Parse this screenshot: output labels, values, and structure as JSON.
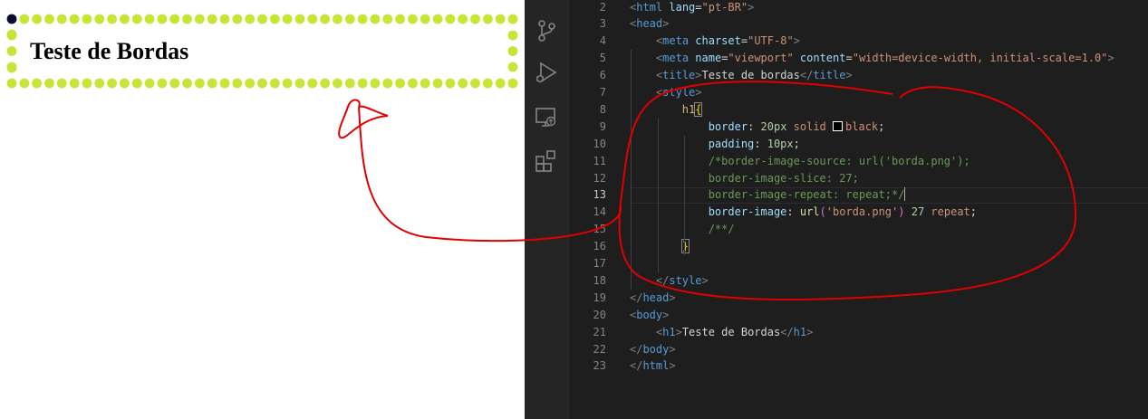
{
  "preview": {
    "heading": "Teste de Bordas",
    "border_color": "#c5e636",
    "corner_color": "#0a0a2e"
  },
  "activity_bar": {
    "icons": [
      "source-control-icon",
      "run-debug-icon",
      "remote-explorer-icon",
      "extensions-icon"
    ]
  },
  "editor": {
    "active_line": 13,
    "lines": [
      {
        "n": "2",
        "parts": [
          {
            "c": "tk-punct",
            "t": "<"
          },
          {
            "c": "tk-tag",
            "t": "html"
          },
          {
            "c": "tk-text",
            "t": " "
          },
          {
            "c": "tk-attr",
            "t": "lang"
          },
          {
            "c": "tk-text",
            "t": "="
          },
          {
            "c": "tk-str",
            "t": "\"pt-BR\""
          },
          {
            "c": "tk-punct",
            "t": ">"
          }
        ]
      },
      {
        "n": "3",
        "parts": [
          {
            "c": "tk-punct",
            "t": "<"
          },
          {
            "c": "tk-tag",
            "t": "head"
          },
          {
            "c": "tk-punct",
            "t": ">"
          }
        ]
      },
      {
        "n": "4",
        "parts": [
          {
            "c": "tk-text",
            "t": "    "
          },
          {
            "c": "tk-punct",
            "t": "<"
          },
          {
            "c": "tk-tag",
            "t": "meta"
          },
          {
            "c": "tk-text",
            "t": " "
          },
          {
            "c": "tk-attr",
            "t": "charset"
          },
          {
            "c": "tk-text",
            "t": "="
          },
          {
            "c": "tk-str",
            "t": "\"UTF-8\""
          },
          {
            "c": "tk-punct",
            "t": ">"
          }
        ]
      },
      {
        "n": "5",
        "parts": [
          {
            "c": "tk-text",
            "t": "    "
          },
          {
            "c": "tk-punct",
            "t": "<"
          },
          {
            "c": "tk-tag",
            "t": "meta"
          },
          {
            "c": "tk-text",
            "t": " "
          },
          {
            "c": "tk-attr",
            "t": "name"
          },
          {
            "c": "tk-text",
            "t": "="
          },
          {
            "c": "tk-str",
            "t": "\"viewport\""
          },
          {
            "c": "tk-text",
            "t": " "
          },
          {
            "c": "tk-attr",
            "t": "content"
          },
          {
            "c": "tk-text",
            "t": "="
          },
          {
            "c": "tk-str",
            "t": "\"width=device-width, initial-scale=1.0\""
          },
          {
            "c": "tk-punct",
            "t": ">"
          }
        ]
      },
      {
        "n": "6",
        "parts": [
          {
            "c": "tk-text",
            "t": "    "
          },
          {
            "c": "tk-punct",
            "t": "<"
          },
          {
            "c": "tk-tag",
            "t": "title"
          },
          {
            "c": "tk-punct",
            "t": ">"
          },
          {
            "c": "tk-text",
            "t": "Teste de bordas"
          },
          {
            "c": "tk-punct",
            "t": "</"
          },
          {
            "c": "tk-tag",
            "t": "title"
          },
          {
            "c": "tk-punct",
            "t": ">"
          }
        ]
      },
      {
        "n": "7",
        "parts": [
          {
            "c": "tk-text",
            "t": "    "
          },
          {
            "c": "tk-punct",
            "t": "<"
          },
          {
            "c": "tk-tag",
            "t": "style"
          },
          {
            "c": "tk-punct",
            "t": ">"
          }
        ]
      },
      {
        "n": "8",
        "parts": [
          {
            "c": "tk-text",
            "t": "        "
          },
          {
            "c": "tk-sel",
            "t": "h1"
          },
          {
            "c": "tk-brace-hl",
            "t": "{"
          }
        ]
      },
      {
        "n": "9",
        "parts": [
          {
            "c": "tk-text",
            "t": "            "
          },
          {
            "c": "tk-prop",
            "t": "border"
          },
          {
            "c": "tk-text",
            "t": ": "
          },
          {
            "c": "tk-num",
            "t": "20px"
          },
          {
            "c": "tk-text",
            "t": " "
          },
          {
            "c": "tk-val",
            "t": "solid"
          },
          {
            "c": "tk-text",
            "t": " "
          },
          {
            "c": "swatch",
            "t": ""
          },
          {
            "c": "tk-val",
            "t": "black"
          },
          {
            "c": "tk-text",
            "t": ";"
          }
        ]
      },
      {
        "n": "10",
        "parts": [
          {
            "c": "tk-text",
            "t": "            "
          },
          {
            "c": "tk-prop",
            "t": "padding"
          },
          {
            "c": "tk-text",
            "t": ": "
          },
          {
            "c": "tk-num",
            "t": "10px"
          },
          {
            "c": "tk-text",
            "t": ";"
          }
        ]
      },
      {
        "n": "11",
        "parts": [
          {
            "c": "tk-text",
            "t": "            "
          },
          {
            "c": "tk-comment",
            "t": "/*border-image-source: url('borda.png');"
          }
        ]
      },
      {
        "n": "12",
        "parts": [
          {
            "c": "tk-text",
            "t": "            "
          },
          {
            "c": "tk-comment",
            "t": "border-image-slice: 27;"
          }
        ]
      },
      {
        "n": "13",
        "parts": [
          {
            "c": "tk-text",
            "t": "            "
          },
          {
            "c": "tk-comment",
            "t": "border-image-repeat: repeat;*/"
          },
          {
            "c": "cursor",
            "t": ""
          }
        ]
      },
      {
        "n": "14",
        "parts": [
          {
            "c": "tk-text",
            "t": "            "
          },
          {
            "c": "tk-prop",
            "t": "border-image"
          },
          {
            "c": "tk-text",
            "t": ": "
          },
          {
            "c": "tk-fn",
            "t": "url"
          },
          {
            "c": "tk-paren",
            "t": "("
          },
          {
            "c": "tk-str",
            "t": "'borda.png'"
          },
          {
            "c": "tk-paren",
            "t": ")"
          },
          {
            "c": "tk-text",
            "t": " "
          },
          {
            "c": "tk-num",
            "t": "27"
          },
          {
            "c": "tk-text",
            "t": " "
          },
          {
            "c": "tk-val",
            "t": "repeat"
          },
          {
            "c": "tk-text",
            "t": ";"
          }
        ]
      },
      {
        "n": "15",
        "parts": [
          {
            "c": "tk-text",
            "t": "            "
          },
          {
            "c": "tk-comment",
            "t": "/**/"
          }
        ]
      },
      {
        "n": "16",
        "parts": [
          {
            "c": "tk-text",
            "t": "        "
          },
          {
            "c": "tk-brace-hl",
            "t": "}"
          }
        ]
      },
      {
        "n": "17",
        "parts": []
      },
      {
        "n": "18",
        "parts": [
          {
            "c": "tk-text",
            "t": "    "
          },
          {
            "c": "tk-punct",
            "t": "</"
          },
          {
            "c": "tk-tag",
            "t": "style"
          },
          {
            "c": "tk-punct",
            "t": ">"
          }
        ]
      },
      {
        "n": "19",
        "parts": [
          {
            "c": "tk-punct",
            "t": "</"
          },
          {
            "c": "tk-tag",
            "t": "head"
          },
          {
            "c": "tk-punct",
            "t": ">"
          }
        ]
      },
      {
        "n": "20",
        "parts": [
          {
            "c": "tk-punct",
            "t": "<"
          },
          {
            "c": "tk-tag",
            "t": "body"
          },
          {
            "c": "tk-punct",
            "t": ">"
          }
        ]
      },
      {
        "n": "21",
        "parts": [
          {
            "c": "tk-text",
            "t": "    "
          },
          {
            "c": "tk-punct",
            "t": "<"
          },
          {
            "c": "tk-tag",
            "t": "h1"
          },
          {
            "c": "tk-punct",
            "t": ">"
          },
          {
            "c": "tk-text",
            "t": "Teste de Bordas"
          },
          {
            "c": "tk-punct",
            "t": "</"
          },
          {
            "c": "tk-tag",
            "t": "h1"
          },
          {
            "c": "tk-punct",
            "t": ">"
          }
        ]
      },
      {
        "n": "22",
        "parts": [
          {
            "c": "tk-punct",
            "t": "</"
          },
          {
            "c": "tk-tag",
            "t": "body"
          },
          {
            "c": "tk-punct",
            "t": ">"
          }
        ]
      },
      {
        "n": "23",
        "parts": [
          {
            "c": "tk-punct",
            "t": "</"
          },
          {
            "c": "tk-tag",
            "t": "html"
          },
          {
            "c": "tk-punct",
            "t": ">"
          }
        ]
      }
    ]
  },
  "annotation": {
    "color": "#e00000"
  }
}
